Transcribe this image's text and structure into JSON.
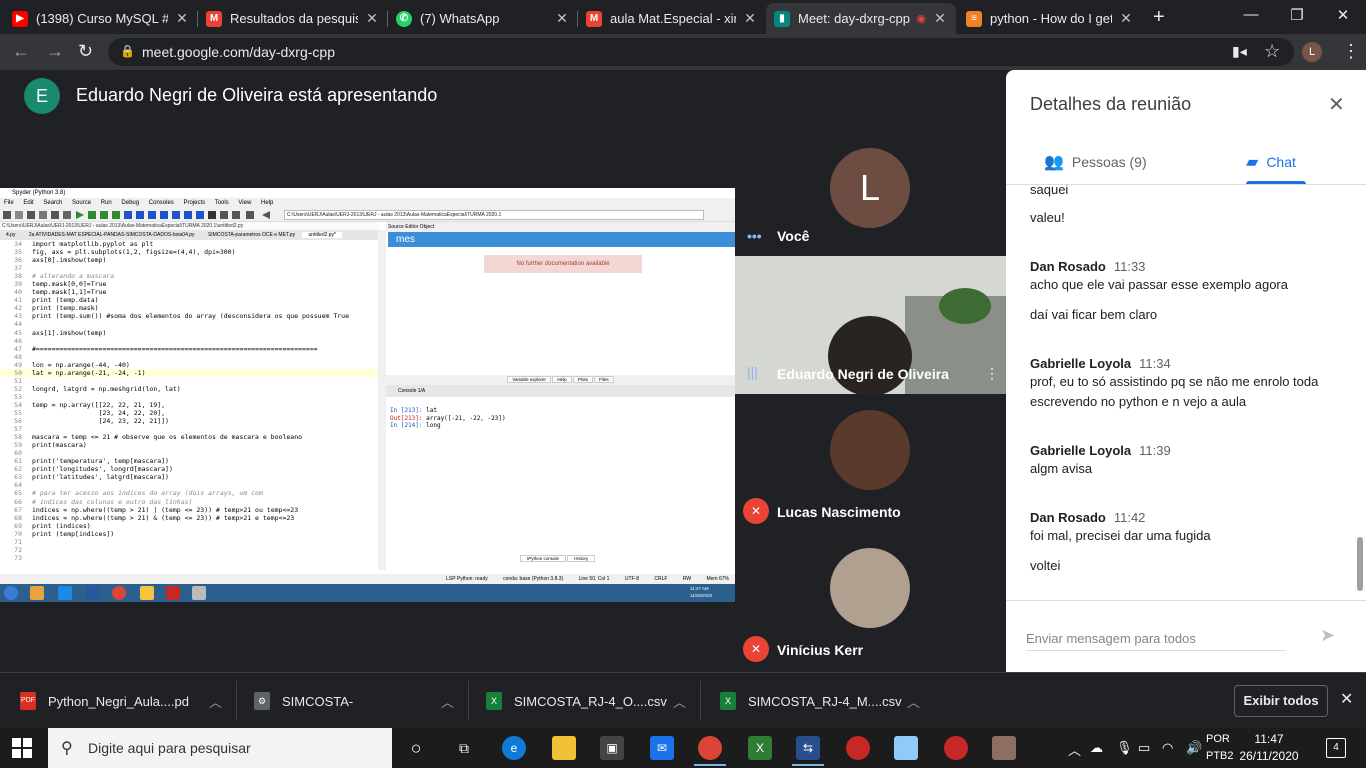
{
  "browser": {
    "tabs": [
      {
        "title": "(1398) Curso MySQL #1",
        "color": "#ff0000",
        "glyph": "▶"
      },
      {
        "title": "Resultados da pesquisa",
        "color": "#ea4335",
        "glyph": "M"
      },
      {
        "title": "(7) WhatsApp",
        "color": "#25d366",
        "glyph": "✆"
      },
      {
        "title": "aula Mat.Especial - ximi",
        "color": "#ea4335",
        "glyph": "M"
      },
      {
        "title": "Meet: day-dxrg-cpp",
        "color": "#00897b",
        "glyph": "▮"
      },
      {
        "title": "python - How do I get t",
        "color": "#f48024",
        "glyph": "≡"
      }
    ],
    "url": "meet.google.com/day-dxrg-cpp",
    "profile_initial": "L"
  },
  "meet": {
    "presenter_initial": "E",
    "presenter_text": "Eduardo Negri de Oliveira está apresentando",
    "participants": [
      {
        "name": "Você",
        "initial": "L"
      },
      {
        "name": "Eduardo Negri de Oliveira"
      },
      {
        "name": "Lucas Nascimento"
      },
      {
        "name": "Vinícius Kerr"
      }
    ]
  },
  "panel": {
    "title": "Detalhes da reunião",
    "tab_people": "Pessoas (9)",
    "tab_chat": "Chat",
    "messages": [
      {
        "type": "text",
        "text": "saquei"
      },
      {
        "type": "text",
        "text": "valeu!"
      },
      {
        "type": "header",
        "author": "Dan Rosado",
        "time": "11:33"
      },
      {
        "type": "text",
        "text": "acho que ele vai passar esse exemplo agora"
      },
      {
        "type": "text",
        "text": "daí vai ficar bem claro"
      },
      {
        "type": "header",
        "author": "Gabrielle Loyola",
        "time": "11:34"
      },
      {
        "type": "text",
        "text": "prof, eu to só assistindo pq se não me enrolo toda escrevendo no python e n vejo a aula"
      },
      {
        "type": "header",
        "author": "Gabrielle Loyola",
        "time": "11:39"
      },
      {
        "type": "text",
        "text": "algm avisa"
      },
      {
        "type": "header",
        "author": "Dan Rosado",
        "time": "11:42"
      },
      {
        "type": "text",
        "text": "foi mal, precisei dar uma fugida"
      },
      {
        "type": "text",
        "text": "voltei"
      }
    ],
    "compose_placeholder": "Enviar mensagem para todos"
  },
  "spyder": {
    "title": "Spyder (Python 3.8)",
    "menu": [
      "File",
      "Edit",
      "Search",
      "Source",
      "Run",
      "Debug",
      "Consoles",
      "Projects",
      "Tools",
      "View",
      "Help"
    ],
    "path": "C:\\Users\\UERJ\\Aulas\\UERJ-2013\\UERJ - aulas 2013\\Aulas-MatematicaEspecial\\TURMA 2020.1",
    "file_path": "C:\\Users\\UERJ\\Aulas\\UERJ-2013\\UERJ - aulas 2013\\Aulas-MatematicaEspecial\\TURMA 2020.1\\untitled2.py",
    "editor_tabs": [
      "4.py",
      "2a ATIVIDADES-MAT ESPECIAL-PANDAS-SIMCOSTA-DADOS-boia04.py",
      "SIMCOSTA-parametros OCE e MET.py",
      "untitled2.py*"
    ],
    "code": [
      {
        "n": "34",
        "t": "import matplotlib.pyplot as plt"
      },
      {
        "n": "35",
        "t": "fig, axs = plt.subplots(1,2, figsize=(4,4), dpi=300)"
      },
      {
        "n": "36",
        "t": "axs[0].imshow(temp)"
      },
      {
        "n": "37",
        "t": ""
      },
      {
        "n": "38",
        "t": "# alterando a mascara",
        "c": true
      },
      {
        "n": "39",
        "t": "temp.mask[0,0]=True"
      },
      {
        "n": "40",
        "t": "temp.mask[1,1]=True"
      },
      {
        "n": "41",
        "t": "print (temp.data)"
      },
      {
        "n": "42",
        "t": "print (temp.mask)"
      },
      {
        "n": "43",
        "t": "print (temp.sum()) #soma dos elementos do array (desconsidera os que possuem True"
      },
      {
        "n": "44",
        "t": ""
      },
      {
        "n": "45",
        "t": "axs[1].imshow(temp)"
      },
      {
        "n": "46",
        "t": ""
      },
      {
        "n": "47",
        "t": "#========================================================================"
      },
      {
        "n": "48",
        "t": ""
      },
      {
        "n": "49",
        "t": "lon = np.arange(-44, -40)"
      },
      {
        "n": "50",
        "t": "lat = np.arange(-21, -24, -1)",
        "h": true
      },
      {
        "n": "51",
        "t": ""
      },
      {
        "n": "52",
        "t": "longrd, latgrd = np.meshgrid(lon, lat)"
      },
      {
        "n": "53",
        "t": ""
      },
      {
        "n": "54",
        "t": "temp = np.array([[22, 22, 21, 19],"
      },
      {
        "n": "55",
        "t": "                 [23, 24, 22, 20],"
      },
      {
        "n": "56",
        "t": "                 [24, 23, 22, 21]])"
      },
      {
        "n": "57",
        "t": ""
      },
      {
        "n": "58",
        "t": "mascara = temp <= 21 # observe que os elementos de mascara e booleano"
      },
      {
        "n": "59",
        "t": "print(mascara)"
      },
      {
        "n": "60",
        "t": ""
      },
      {
        "n": "61",
        "t": "print('temperatura', temp[mascara])"
      },
      {
        "n": "62",
        "t": "print('longitudes', longrd[mascara])"
      },
      {
        "n": "63",
        "t": "print('latitudes', latgrd[mascara])"
      },
      {
        "n": "64",
        "t": ""
      },
      {
        "n": "65",
        "t": "# para ter acesso aos indices do array (dois arrays, um com",
        "c": true
      },
      {
        "n": "66",
        "t": "# indices das colunas e outro das linhas)",
        "c": true
      },
      {
        "n": "67",
        "t": "indices = np.where((temp > 21) | (temp <= 23)) # temp>21 ou temp<=23"
      },
      {
        "n": "68",
        "t": "indices = np.where((temp > 21) & (temp <= 23)) # temp>21 e temp<=23"
      },
      {
        "n": "69",
        "t": "print (indices)"
      },
      {
        "n": "70",
        "t": "print (temp[indices])"
      },
      {
        "n": "71",
        "t": ""
      },
      {
        "n": "72",
        "t": ""
      },
      {
        "n": "73",
        "t": ""
      }
    ],
    "help_source": "Source  Editor    Object",
    "help_title": "mes",
    "no_doc": "No further documentation available",
    "pane_tabs": [
      "Variable explorer",
      "Help",
      "Plots",
      "Files"
    ],
    "console_tab": "Console 1/A",
    "console": [
      {
        "p": "In [213]: ",
        "t": "lat",
        "k": "in"
      },
      {
        "p": "Out[213]: ",
        "t": "array([-21, -22, -23])",
        "k": "out"
      },
      {
        "p": "",
        "t": "",
        "k": "blank"
      },
      {
        "p": "In [214]: ",
        "t": "long",
        "k": "in"
      }
    ],
    "console_bottom_tabs": [
      "IPython console",
      "History"
    ],
    "status": [
      "LSP Python: ready",
      "conda: base (Python 3.8.3)",
      "Line 50, Col 1",
      "UTF-8",
      "CRLF",
      "RW",
      "Mem 67%"
    ],
    "win7_time": "11:47 AM",
    "win7_date": "11/26/2020"
  },
  "downloads": {
    "items": [
      {
        "name": "Python_Negri_Aula....pd",
        "color": "#d93025",
        "glyph": "PDF"
      },
      {
        "name": "SIMCOSTA-",
        "color": "#5f6368",
        "glyph": "⚙"
      },
      {
        "name": "SIMCOSTA_RJ-4_O....csv",
        "color": "#188038",
        "glyph": "X"
      },
      {
        "name": "SIMCOSTA_RJ-4_M....csv",
        "color": "#188038",
        "glyph": "X"
      }
    ],
    "show_all": "Exibir todos"
  },
  "taskbar": {
    "search_placeholder": "Digite aqui para pesquisar",
    "lang_top": "POR",
    "lang_bottom": "PTB2",
    "time": "11:47",
    "date": "26/11/2020",
    "notifications": "4"
  }
}
